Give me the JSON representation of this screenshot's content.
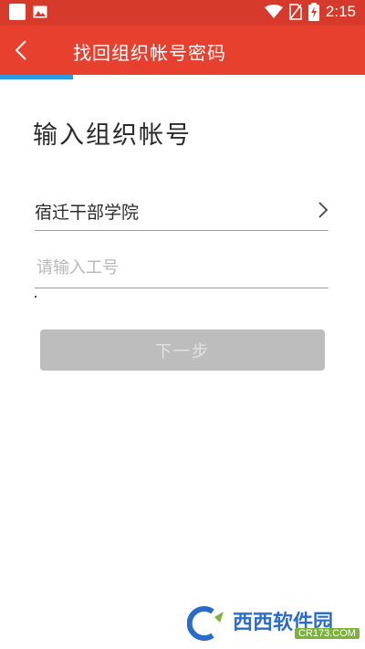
{
  "status_bar": {
    "time": "2:15"
  },
  "app_bar": {
    "title": "找回组织帐号密码"
  },
  "page": {
    "heading": "输入组织帐号"
  },
  "organization": {
    "selected": "宿迁干部学院"
  },
  "employee_id": {
    "placeholder": "请输入工号",
    "value": ""
  },
  "next_button": {
    "label": "下一步"
  },
  "progress": {
    "fraction": 0.2
  },
  "watermark": {
    "brand": "西西软件园",
    "site": "CR173.COM"
  },
  "colors": {
    "app_bar": "#e8402e",
    "status_bar": "#d63a2a",
    "progress": "#2e9ae0",
    "button_disabled": "#bdbdbd"
  },
  "icons": [
    "square-icon",
    "image-icon",
    "wifi-icon",
    "no-sim-icon",
    "battery-charging-icon",
    "back-arrow-icon",
    "chevron-right-icon"
  ]
}
